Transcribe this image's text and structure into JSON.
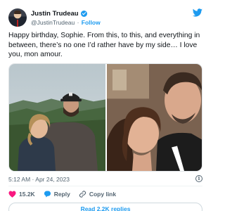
{
  "author": {
    "name": "Justin Trudeau",
    "handle": "@JustinTrudeau",
    "separator": "·",
    "follow_label": "Follow"
  },
  "tweet": {
    "text": "Happy birthday, Sophie. From this, to this, and everything in between, there’s no one I’d rather have by my side… I love you, mon amour.",
    "timestamp": "5:12 AM · Apr 24, 2023"
  },
  "actions": {
    "likes": "15.2K",
    "reply_label": "Reply",
    "copy_label": "Copy link"
  },
  "read_replies_label": "Read 2.2K replies",
  "colors": {
    "accent": "#1d9bf0",
    "like": "#f91880",
    "text": "#0f1419",
    "muted": "#536471"
  },
  "icons": [
    "twitter-bird-icon",
    "verified-badge-icon",
    "heart-icon",
    "reply-icon",
    "link-icon",
    "info-icon"
  ]
}
